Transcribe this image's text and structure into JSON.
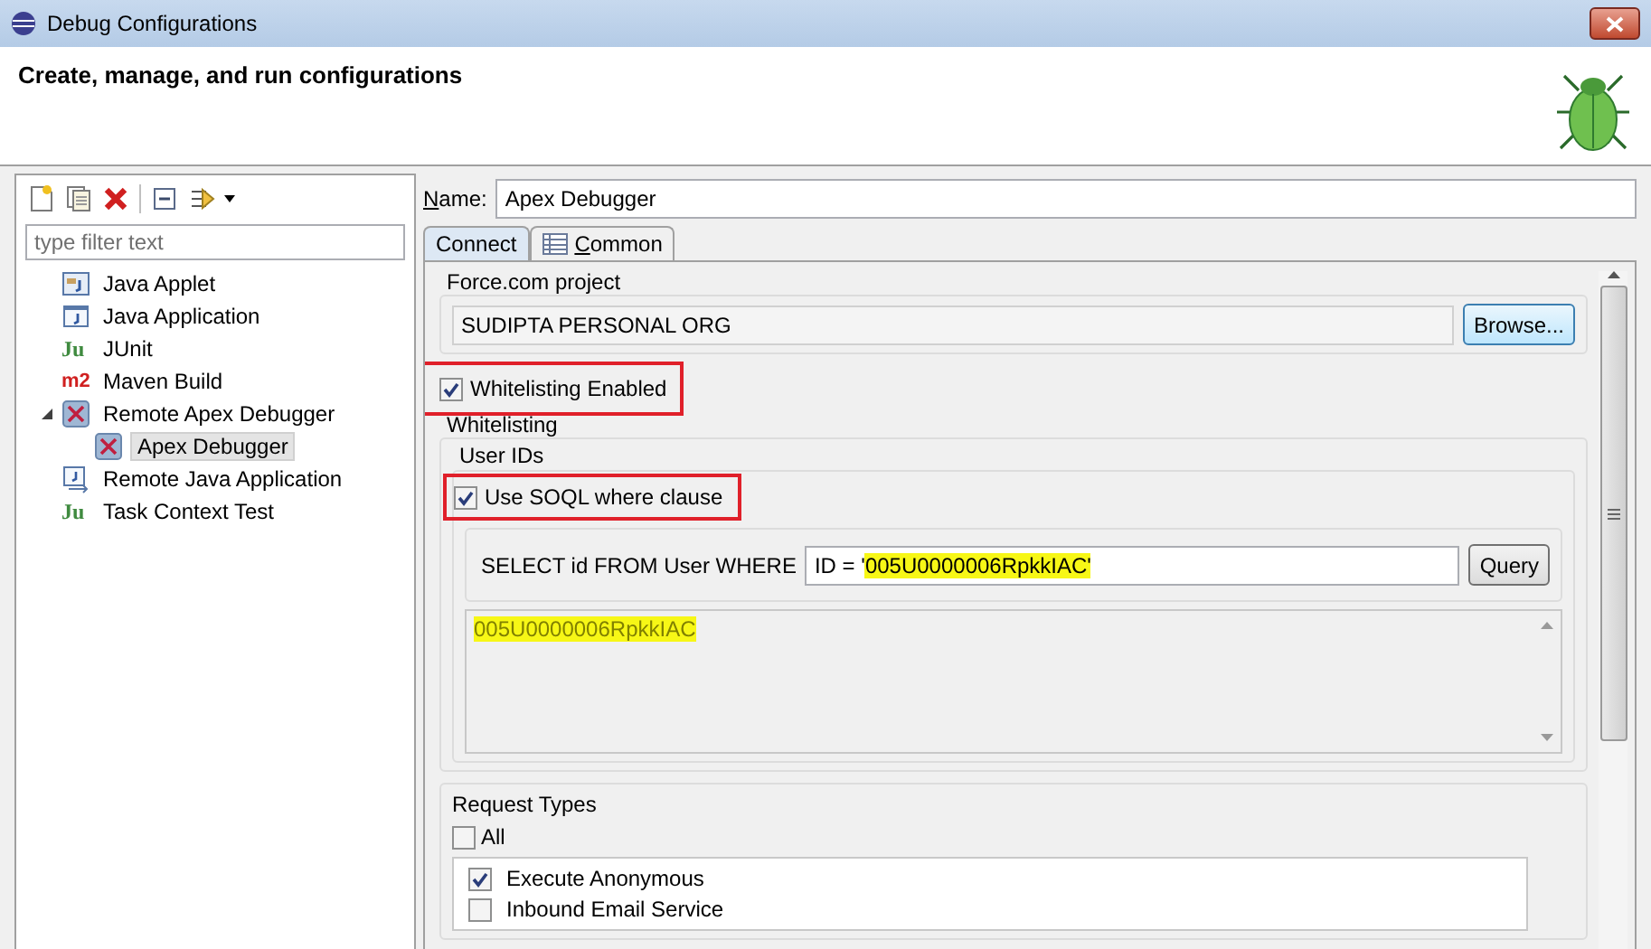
{
  "window": {
    "title": "Debug Configurations"
  },
  "header": {
    "title": "Create, manage, and run configurations"
  },
  "filter": {
    "placeholder": "type filter text"
  },
  "tree": [
    {
      "label": "Java Applet",
      "kind": "applet",
      "selected": false
    },
    {
      "label": "Java Application",
      "kind": "application",
      "selected": false
    },
    {
      "label": "JUnit",
      "kind": "junit",
      "icon_text": "Ju",
      "selected": false
    },
    {
      "label": "Maven Build",
      "kind": "maven",
      "icon_text": "m2",
      "selected": false
    },
    {
      "label": "Remote Apex Debugger",
      "kind": "apex",
      "selected": false,
      "expanded": true,
      "children": [
        {
          "label": "Apex Debugger",
          "kind": "apex",
          "selected": true
        }
      ]
    },
    {
      "label": "Remote Java Application",
      "kind": "remote",
      "selected": false
    },
    {
      "label": "Task Context Test",
      "kind": "task",
      "icon_text": "Ju",
      "selected": false
    }
  ],
  "name_field": {
    "label": "Name:",
    "value": "Apex Debugger"
  },
  "tabs": [
    {
      "label": "Connect",
      "selected": true
    },
    {
      "label": "Common",
      "selected": false
    }
  ],
  "project": {
    "label": "Force.com project",
    "value": "SUDIPTA PERSONAL ORG",
    "button": "Browse..."
  },
  "whitelisting_enabled": {
    "label": "Whitelisting Enabled",
    "checked": true
  },
  "whitelisting": {
    "label": "Whitelisting",
    "user_ids_label": "User IDs",
    "use_soql": {
      "label": "Use SOQL where clause",
      "checked": true
    },
    "query_label": "SELECT id FROM User WHERE",
    "query_prefix": "ID = '",
    "query_highlighted": "005U0000006RpkkIAC'",
    "query_button": "Query",
    "results": [
      "005U0000006RpkkIAC"
    ]
  },
  "request_types": {
    "label": "Request Types",
    "all": {
      "label": "All",
      "checked": false
    },
    "items": [
      {
        "label": "Execute Anonymous",
        "checked": true
      },
      {
        "label": "Inbound Email Service",
        "checked": false
      }
    ]
  }
}
